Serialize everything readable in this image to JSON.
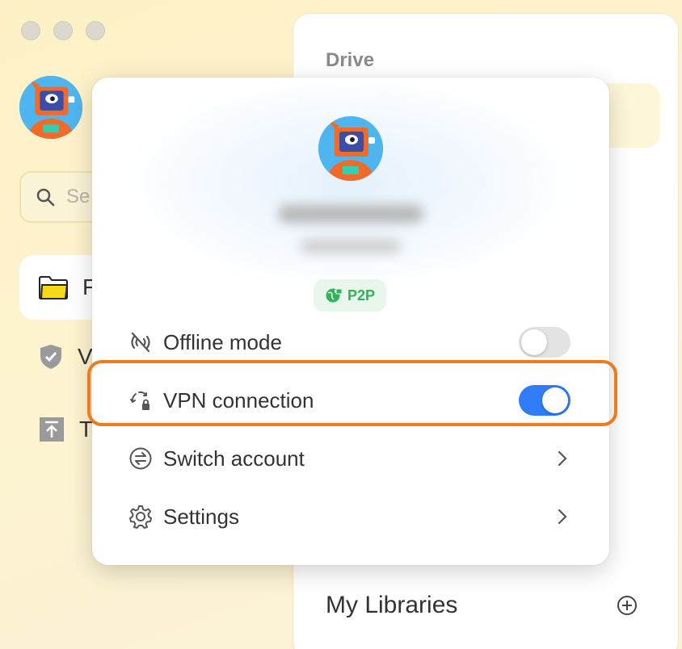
{
  "sidebar": {
    "search_placeholder": "Se",
    "items": [
      {
        "label": "F",
        "icon": "folder-icon"
      },
      {
        "label": "V",
        "icon": "shield-icon"
      },
      {
        "label": "T",
        "icon": "upload-icon"
      }
    ]
  },
  "panel": {
    "drive_label": "Drive",
    "libraries_label": "My Libraries"
  },
  "popup": {
    "badge": "P2P",
    "rows": [
      {
        "label": "Offline mode",
        "icon": "offline-icon",
        "control": "toggle",
        "state": "off"
      },
      {
        "label": "VPN connection",
        "icon": "vpn-icon",
        "control": "toggle",
        "state": "on"
      },
      {
        "label": "Switch account",
        "icon": "switch-account-icon",
        "control": "chevron"
      },
      {
        "label": "Settings",
        "icon": "gear-icon",
        "control": "chevron"
      }
    ]
  },
  "colors": {
    "accent": "#2f7cf6",
    "badge_green": "#2fb45a",
    "highlight": "#f07a1e",
    "background": "#fdf1c6"
  }
}
